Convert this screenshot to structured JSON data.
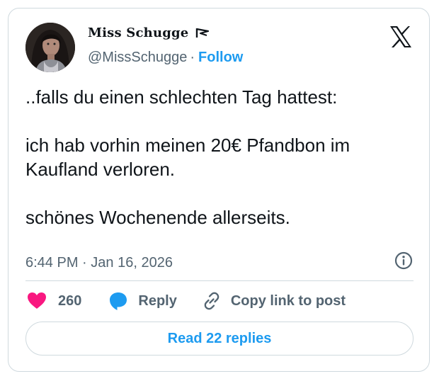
{
  "author": {
    "display_name": "Miss Schugge",
    "handle": "@MissSchugge",
    "follow_label": "Follow",
    "avatar": "profile-photo"
  },
  "platform_icon": "x-logo-icon",
  "tweet": {
    "text": "..falls du einen schlechten Tag hattest:\n\nich hab vorhin meinen 20€ Pfandbon im Kaufland verloren.\n\nschönes Wochenende allerseits.",
    "time": "6:44 PM",
    "separator": "·",
    "date": "Jan 16, 2026"
  },
  "actions": {
    "likes": "260",
    "reply_label": "Reply",
    "copy_label": "Copy link to post"
  },
  "read_replies_label": "Read 22 replies",
  "colors": {
    "accent": "#1d9bf0",
    "like": "#f91880",
    "text": "#0f1419",
    "muted": "#536471",
    "border": "#cfd9de"
  }
}
